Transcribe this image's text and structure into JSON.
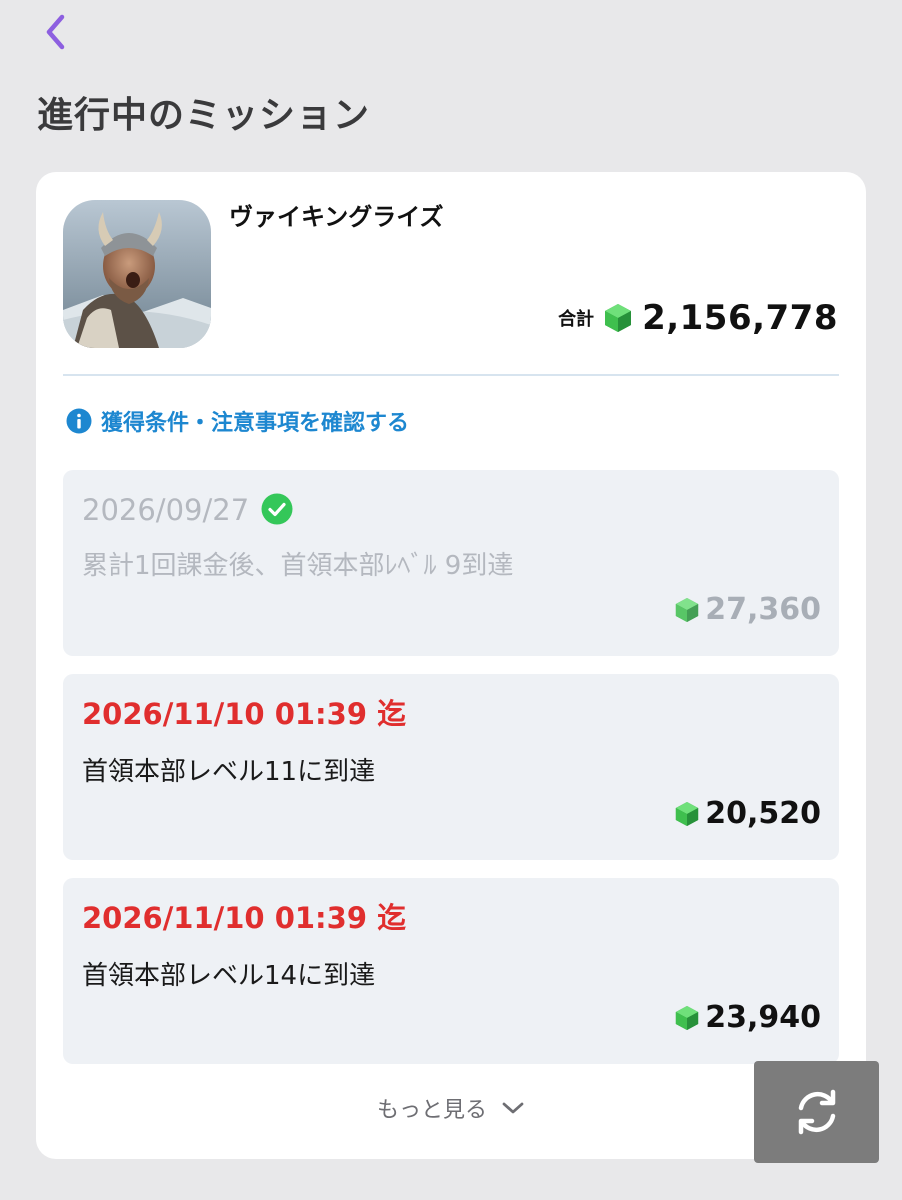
{
  "header": {
    "back_icon": "chevron-left-icon",
    "title": "進行中のミッション"
  },
  "colors": {
    "accent": "#8d5fe0",
    "link": "#1d87d0",
    "deadline": "#e02e2e",
    "check": "#34c759",
    "gem": "#35c24a"
  },
  "app": {
    "name": "ヴァイキングライズ",
    "total_label": "合計",
    "total_value": "2,156,778",
    "gem_icon": "gem-icon"
  },
  "notice": {
    "icon": "info-icon",
    "text": "獲得条件・注意事項を確認する"
  },
  "missions": [
    {
      "date": "2026/09/27",
      "status": "completed",
      "status_icon": "check-circle-icon",
      "description": "累計1回課金後、首領本部ﾚﾍﾞﾙ 9到達",
      "reward": "27,360"
    },
    {
      "date": "2026/11/10 01:39 迄",
      "status": "active",
      "description": "首領本部レベル11に到達",
      "reward": "20,520"
    },
    {
      "date": "2026/11/10 01:39 迄",
      "status": "active",
      "description": "首領本部レベル14に到達",
      "reward": "23,940"
    }
  ],
  "more": {
    "label": "もっと見る",
    "icon": "chevron-down-icon"
  },
  "refresh": {
    "icon": "refresh-icon"
  }
}
